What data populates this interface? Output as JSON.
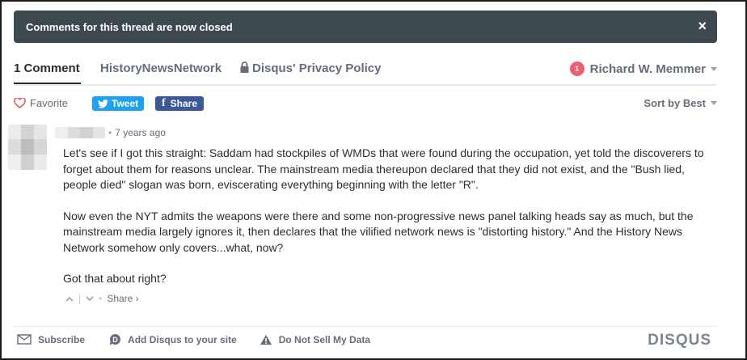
{
  "banner": {
    "text": "Comments for this thread are now closed",
    "close_glyph": "×"
  },
  "nav": {
    "comments_tab": "1 Comment",
    "site_tab": "HistoryNewsNetwork",
    "privacy_tab": "Disqus' Privacy Policy",
    "user": {
      "name": "Richard W. Memmer",
      "notification_count": "1"
    }
  },
  "toolbar": {
    "favorite_label": "Favorite",
    "tweet_label": "Tweet",
    "share_label": "Share",
    "sort_label": "Sort by Best"
  },
  "comment": {
    "age": "7 years ago",
    "paragraphs": [
      "Let's see if I got this straight: Saddam had stockpiles of WMDs that were found during the occupation, yet told the discoverers to forget about them for reasons unclear. The mainstream media thereupon declared that they did not exist, and the \"Bush lied, people died\" slogan was born, eviscerating everything beginning with the letter \"R\".",
      "Now even the NYT admits the weapons were there and some non-progressive news panel talking heads say as much, but the mainstream media largely ignores it, then declares that the vilified network news is \"distorting history.\" And the History News Network somehow only covers...what, now?",
      "Got that about right?"
    ],
    "share_label": "Share ›"
  },
  "footer": {
    "subscribe_label": "Subscribe",
    "add_disqus_label": "Add Disqus to your site",
    "do_not_sell_label": "Do Not Sell My Data",
    "logo_text": "DISQUS"
  },
  "colors": {
    "banner_bg": "#3e484f",
    "tweet": "#1da1f2",
    "facebook": "#3b5998",
    "notification": "#f05f70",
    "heart": "#e04a4a"
  }
}
